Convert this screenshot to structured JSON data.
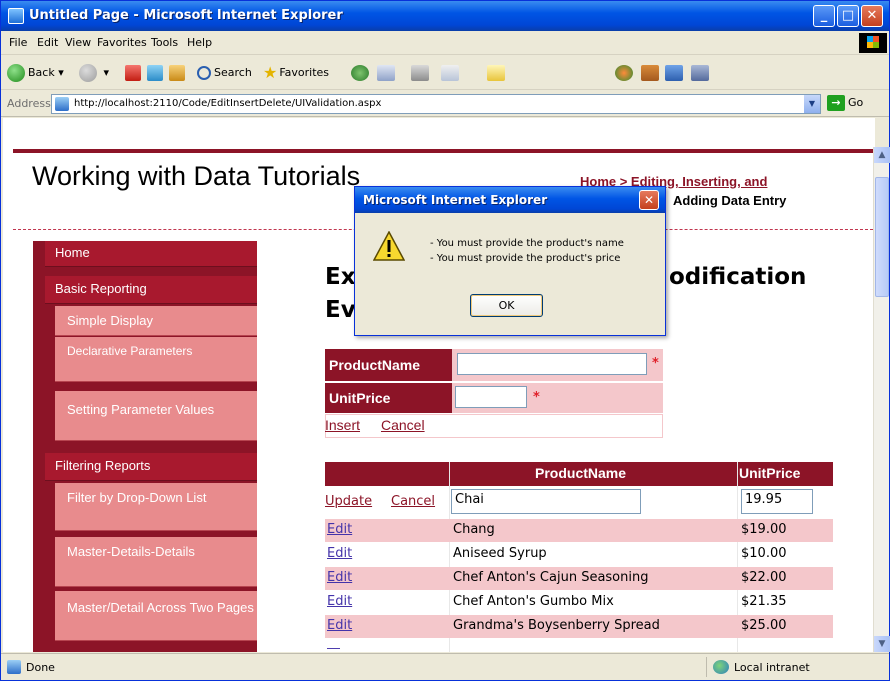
{
  "window": {
    "title": "Untitled Page - Microsoft Internet Explorer"
  },
  "menu": [
    "File",
    "Edit",
    "View",
    "Favorites",
    "Tools",
    "Help"
  ],
  "toolbar": {
    "back": "Back",
    "search": "Search",
    "favorites": "Favorites"
  },
  "address": {
    "label": "Address",
    "url": "http://localhost:2110/Code/EditInsertDelete/UIValidation.aspx",
    "go": "Go"
  },
  "site": {
    "title": "Working with Data Tutorials",
    "breadcrumb_link": "Home > Editing, Inserting, and",
    "breadcrumb_tail": "Adding Data Entry"
  },
  "sidebar": {
    "items": [
      {
        "label": "Home",
        "level": "top"
      },
      {
        "label": "Basic Reporting",
        "level": "top"
      },
      {
        "label": "Simple Display",
        "level": "sub"
      },
      {
        "label": "Declarative Parameters",
        "level": "sub"
      },
      {
        "label": "Setting Parameter Values",
        "level": "sub"
      },
      {
        "label": "Filtering Reports",
        "level": "top"
      },
      {
        "label": "Filter by Drop-Down List",
        "level": "sub"
      },
      {
        "label": "Master-Details-Details",
        "level": "sub"
      },
      {
        "label": "Master/Detail Across Two Pages",
        "level": "sub"
      }
    ]
  },
  "page": {
    "heading_part1": "Ex",
    "heading_part2": "Ev",
    "heading_visible_right": "odification"
  },
  "insert_form": {
    "fields": [
      {
        "label": "ProductName",
        "value": "",
        "required_marker": "*"
      },
      {
        "label": "UnitPrice",
        "value": "",
        "required_marker": "*"
      }
    ],
    "insert_link": "Insert",
    "cancel_link": "Cancel"
  },
  "grid": {
    "columns": [
      "",
      "ProductName",
      "UnitPrice"
    ],
    "edit_row": {
      "update": "Update",
      "cancel": "Cancel",
      "product": "Chai",
      "price": "19.95"
    },
    "rows": [
      {
        "action": "Edit",
        "product": "Chang",
        "price": "$19.00"
      },
      {
        "action": "Edit",
        "product": "Aniseed Syrup",
        "price": "$10.00"
      },
      {
        "action": "Edit",
        "product": "Chef Anton's Cajun Seasoning",
        "price": "$22.00"
      },
      {
        "action": "Edit",
        "product": "Chef Anton's Gumbo Mix",
        "price": "$21.35"
      },
      {
        "action": "Edit",
        "product": "Grandma's Boysenberry Spread",
        "price": "$25.00"
      }
    ]
  },
  "dialog": {
    "title": "Microsoft Internet Explorer",
    "messages": [
      "- You must provide the product's name",
      "- You must provide the product's price"
    ],
    "ok": "OK"
  },
  "status": {
    "text": "Done",
    "zone": "Local intranet"
  },
  "colors": {
    "brand": "#8c1427",
    "row_alt": "#f4c7cb",
    "xp_blue": "#0055e5"
  }
}
